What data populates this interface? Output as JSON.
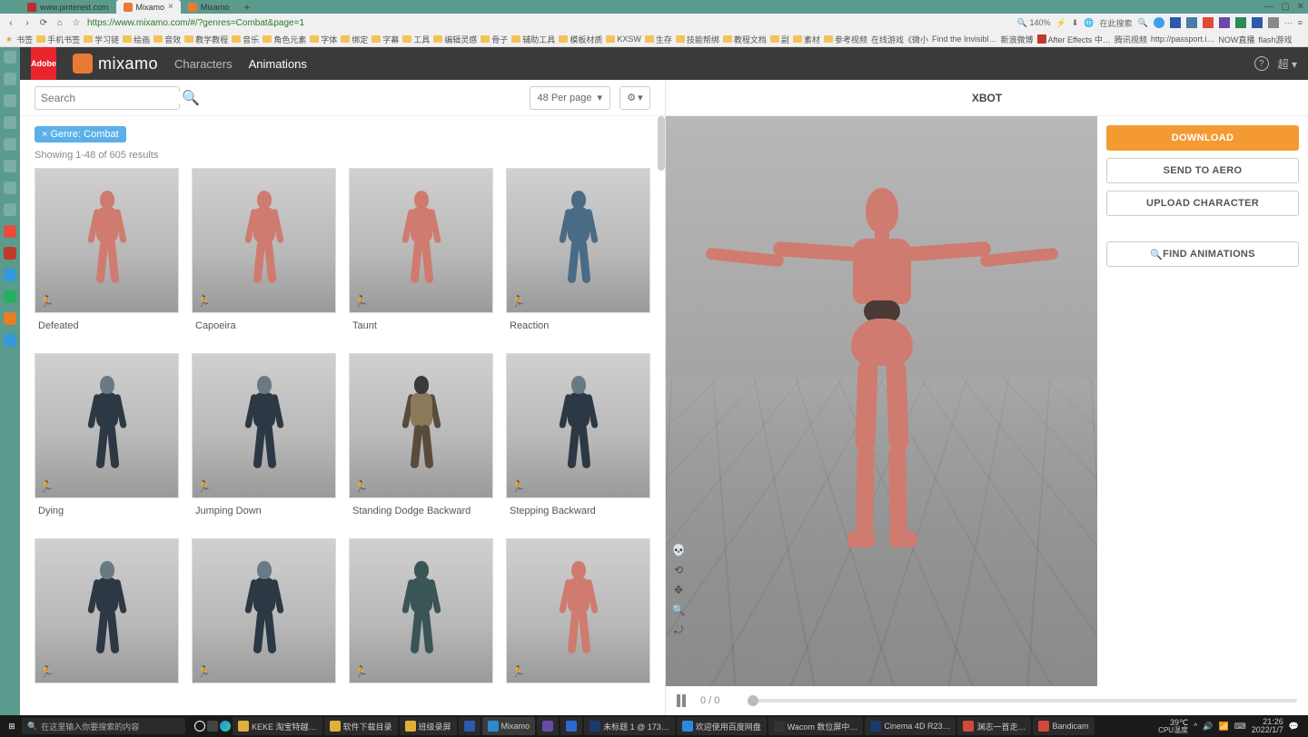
{
  "tabs": [
    {
      "label": "www.pinterest.com"
    },
    {
      "label": "Mixamo"
    },
    {
      "label": "Mixamo"
    }
  ],
  "url": "https://www.mixamo.com/#/?genres=Combat&page=1",
  "zoom": "140%",
  "addr_placeholder": "在此搜索",
  "bookmarks": [
    "书签",
    "手机书签",
    "学习链",
    "绘画",
    "音效",
    "教学教程",
    "音乐",
    "角色元素",
    "字体",
    "绑定",
    "字幕",
    "工具",
    "编辑灵感",
    "骨子",
    "辅助工具",
    "模板材质",
    "KXSW",
    "生存",
    "技能帮绑",
    "教程文档",
    "副",
    "素材",
    "参考视频",
    "在线游戏《微小",
    "Find the Invisibl…",
    "新浪微博",
    "After Effects 中…",
    "腾讯视频",
    "http://passport.i…",
    "NOW直播",
    "flash游戏"
  ],
  "brand": "mixamo",
  "nav": {
    "characters": "Characters",
    "animations": "Animations"
  },
  "user_menu": "超",
  "search": {
    "placeholder": "Search"
  },
  "per_page": "48 Per page",
  "filter_tag": "× Genre: Combat",
  "results": "Showing 1-48 of 605 results",
  "cards": [
    {
      "label": "Defeated",
      "color": "pink"
    },
    {
      "label": "Capoeira",
      "color": "pink"
    },
    {
      "label": "Taunt",
      "color": "pink"
    },
    {
      "label": "Reaction",
      "color": "blue"
    },
    {
      "label": "Dying",
      "color": "navy"
    },
    {
      "label": "Jumping Down",
      "color": "navy"
    },
    {
      "label": "Standing Dodge Backward",
      "color": "tan"
    },
    {
      "label": "Stepping Backward",
      "color": "navy"
    },
    {
      "label": "",
      "color": "navy"
    },
    {
      "label": "",
      "color": "navy"
    },
    {
      "label": "",
      "color": "monster"
    },
    {
      "label": "",
      "color": "pink"
    }
  ],
  "viewer_title": "XBOT",
  "playbar": {
    "frames": "0 / 0"
  },
  "actions": {
    "download": "DOWNLOAD",
    "send_aero": "SEND TO AERO",
    "upload": "UPLOAD CHARACTER",
    "find": "FIND ANIMATIONS"
  },
  "taskbar": {
    "search_placeholder": "在这里输入你要搜索的内容",
    "items": [
      {
        "label": "KEKE 淘宝特越…",
        "color": "#e0b03a"
      },
      {
        "label": "软件下载目录",
        "color": "#e0b03a"
      },
      {
        "label": "班级录屏",
        "color": "#e0b03a"
      },
      {
        "label": "",
        "color": "#2d5aa8"
      },
      {
        "label": "Mixamo",
        "color": "#2d8acf",
        "active": true
      },
      {
        "label": "",
        "color": "#6a4aa8"
      },
      {
        "label": "",
        "color": "#2d6acf"
      },
      {
        "label": "未标题 1 @ 173…",
        "color": "#1a3a6a"
      },
      {
        "label": "欢迎使用百度网盘",
        "color": "#2a8ae0"
      },
      {
        "label": "Wacom 数位屏中…",
        "color": "#333333"
      },
      {
        "label": "Cinema 4D R23…",
        "color": "#1a3a6a"
      },
      {
        "label": "渊志一首走…",
        "color": "#d04a3a"
      },
      {
        "label": "Bandicam",
        "color": "#d04a3a"
      }
    ],
    "temp": "39℃",
    "cpu": "CPU温度",
    "time": "21:26",
    "date": "2022/1/7"
  }
}
